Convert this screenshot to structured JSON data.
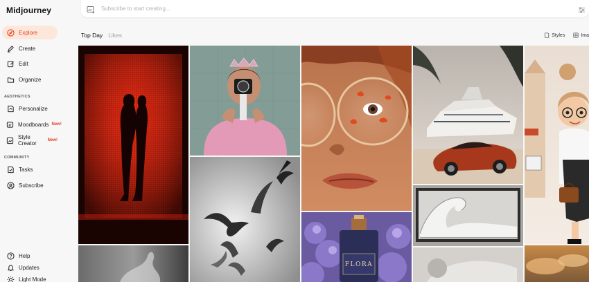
{
  "app": {
    "title": "Midjourney"
  },
  "sidebar": {
    "items": [
      {
        "label": "Explore",
        "icon": "compass-icon",
        "active": true
      },
      {
        "label": "Create",
        "icon": "brush-icon"
      },
      {
        "label": "Edit",
        "icon": "edit-icon"
      },
      {
        "label": "Organize",
        "icon": "folder-icon"
      }
    ],
    "aesthetics_label": "AESTHETICS",
    "aesthetics_items": [
      {
        "label": "Personalize",
        "icon": "personalize-icon"
      },
      {
        "label": "Moodboards",
        "icon": "moodboard-icon",
        "badge": "New!"
      },
      {
        "label": "Style Creator",
        "icon": "style-creator-icon",
        "badge": "New!"
      }
    ],
    "community_label": "COMMUNITY",
    "community_items": [
      {
        "label": "Tasks",
        "icon": "tasks-icon"
      },
      {
        "label": "Subscribe",
        "icon": "user-circle-icon"
      }
    ],
    "bottom_items": [
      {
        "label": "Help",
        "icon": "help-icon"
      },
      {
        "label": "Updates",
        "icon": "bell-icon"
      },
      {
        "label": "Light Mode",
        "icon": "sun-icon"
      }
    ]
  },
  "search": {
    "placeholder": "Subscribe to start creating..."
  },
  "tabs": [
    {
      "label": "Top Day",
      "active": true
    },
    {
      "label": "Likes",
      "active": false
    }
  ],
  "right_tabs": [
    {
      "label": "Styles"
    },
    {
      "label": "Ima"
    }
  ],
  "gallery_text": {
    "perfume_label": "FLORA"
  },
  "colors": {
    "accent": "#e1401c",
    "active_bg": "#fde7db",
    "background": "#f7f7f7"
  }
}
